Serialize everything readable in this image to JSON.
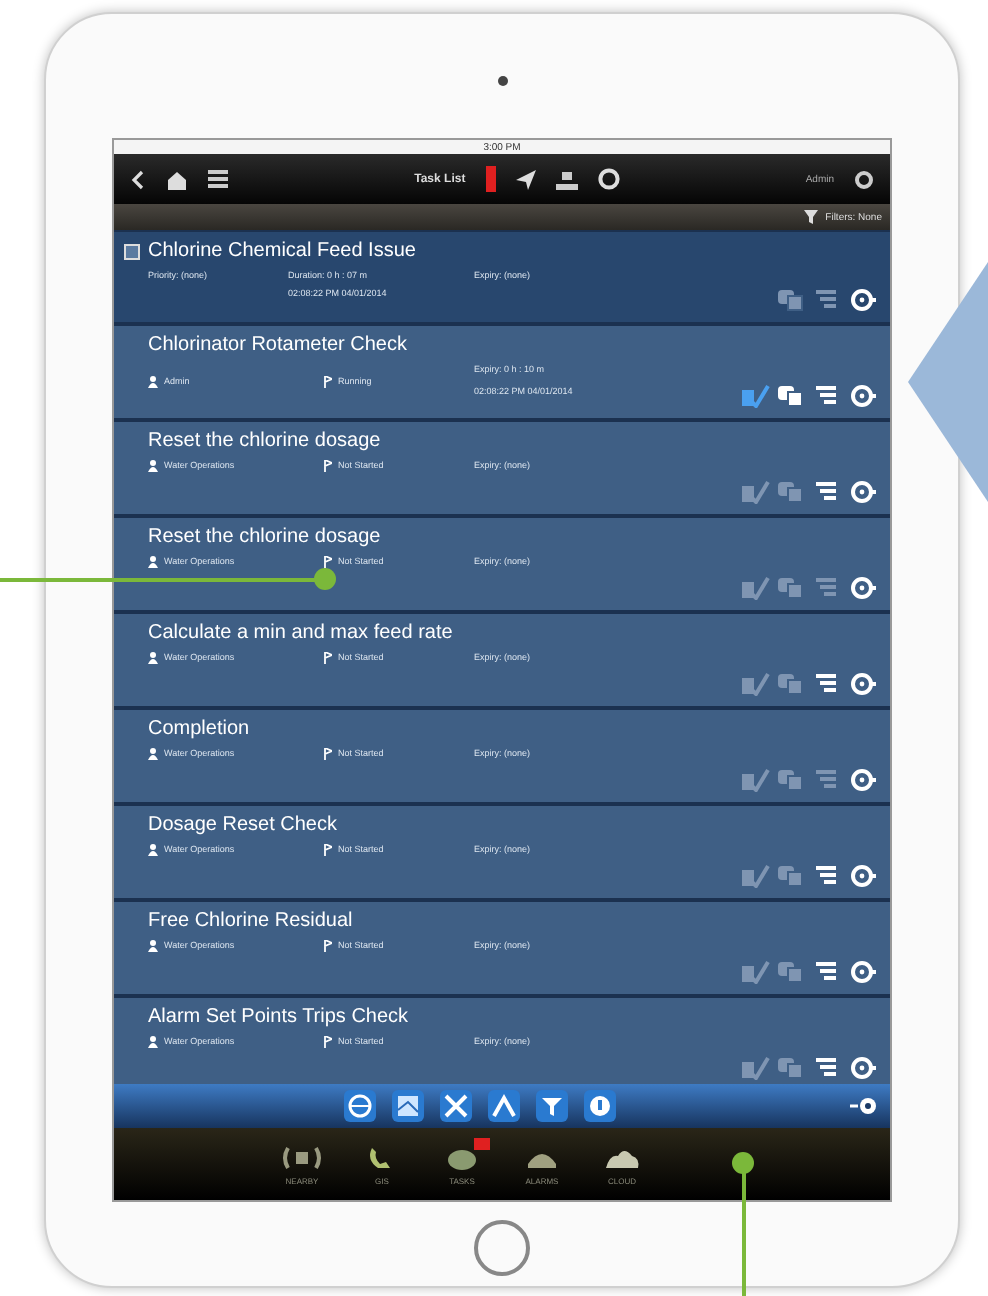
{
  "status_bar": {
    "time": "3:00 PM"
  },
  "nav_bar": {
    "title": "Task List",
    "user": "Admin"
  },
  "filter_bar": {
    "label": "Filters: None"
  },
  "task_group": {
    "title": "Chlorine Chemical Feed Issue",
    "checked": false,
    "priority": "Priority: (none)",
    "duration": "Duration: 0 h : 07 m",
    "expiry": "Expiry: (none)",
    "timestamp": "02:08:22 PM 04/01/2014",
    "actions": [
      {
        "kind": "copy",
        "on": false
      },
      {
        "kind": "notes",
        "on": false
      },
      {
        "kind": "clock",
        "on": true
      }
    ]
  },
  "tasks": [
    {
      "title": "Chlorinator Rotameter Check",
      "assignee": "Admin",
      "status": "Running",
      "expiry": "Expiry: 0 h : 10 m",
      "timestamp": "02:08:22 PM 04/01/2014",
      "actions": [
        {
          "kind": "edit",
          "on": true
        },
        {
          "kind": "copy",
          "on": true
        },
        {
          "kind": "notes",
          "on": true
        },
        {
          "kind": "clock",
          "on": true
        }
      ]
    },
    {
      "title": "Reset the chlorine dosage",
      "assignee": "Water Operations",
      "status": "Not Started",
      "expiry": "Expiry: (none)",
      "actions": [
        {
          "kind": "edit",
          "on": false
        },
        {
          "kind": "copy",
          "on": false
        },
        {
          "kind": "notes",
          "on": true
        },
        {
          "kind": "clock",
          "on": true
        }
      ]
    },
    {
      "title": "Reset the chlorine dosage",
      "assignee": "Water Operations",
      "status": "Not Started",
      "expiry": "Expiry: (none)",
      "actions": [
        {
          "kind": "edit",
          "on": false
        },
        {
          "kind": "copy",
          "on": false
        },
        {
          "kind": "notes",
          "on": false
        },
        {
          "kind": "clock",
          "on": true
        }
      ]
    },
    {
      "title": "Calculate a min and max feed rate",
      "assignee": "Water Operations",
      "status": "Not Started",
      "expiry": "Expiry: (none)",
      "actions": [
        {
          "kind": "edit",
          "on": false
        },
        {
          "kind": "copy",
          "on": false
        },
        {
          "kind": "notes",
          "on": true
        },
        {
          "kind": "clock",
          "on": true
        }
      ]
    },
    {
      "title": "Completion",
      "assignee": "Water Operations",
      "status": "Not Started",
      "expiry": "Expiry: (none)",
      "actions": [
        {
          "kind": "edit",
          "on": false
        },
        {
          "kind": "copy",
          "on": false
        },
        {
          "kind": "notes",
          "on": false
        },
        {
          "kind": "clock",
          "on": true
        }
      ]
    },
    {
      "title": "Dosage Reset Check",
      "assignee": "Water Operations",
      "status": "Not Started",
      "expiry": "Expiry: (none)",
      "actions": [
        {
          "kind": "edit",
          "on": false
        },
        {
          "kind": "copy",
          "on": false
        },
        {
          "kind": "notes",
          "on": true
        },
        {
          "kind": "clock",
          "on": true
        }
      ]
    },
    {
      "title": "Free Chlorine Residual",
      "assignee": "Water Operations",
      "status": "Not Started",
      "expiry": "Expiry: (none)",
      "actions": [
        {
          "kind": "edit",
          "on": false
        },
        {
          "kind": "copy",
          "on": false
        },
        {
          "kind": "notes",
          "on": true
        },
        {
          "kind": "clock",
          "on": true
        }
      ]
    },
    {
      "title": "Alarm Set Points Trips Check",
      "assignee": "Water Operations",
      "status": "Not Started",
      "expiry": "Expiry: (none)",
      "actions": [
        {
          "kind": "edit",
          "on": false
        },
        {
          "kind": "copy",
          "on": false
        },
        {
          "kind": "notes",
          "on": true
        },
        {
          "kind": "clock",
          "on": true
        }
      ]
    }
  ],
  "tool_bar": [
    {
      "kind": "globe"
    },
    {
      "kind": "map"
    },
    {
      "kind": "tools"
    },
    {
      "kind": "chart"
    },
    {
      "kind": "filter"
    },
    {
      "kind": "help"
    }
  ],
  "tab_bar": [
    {
      "label": "NEARBY",
      "kind": "signal",
      "badge": false
    },
    {
      "label": "GIS",
      "kind": "phone",
      "badge": false
    },
    {
      "label": "TASKS",
      "kind": "tasks",
      "badge": true
    },
    {
      "label": "ALARMS",
      "kind": "alarm",
      "badge": false
    },
    {
      "label": "CLOUD",
      "kind": "cloud",
      "badge": false
    }
  ]
}
